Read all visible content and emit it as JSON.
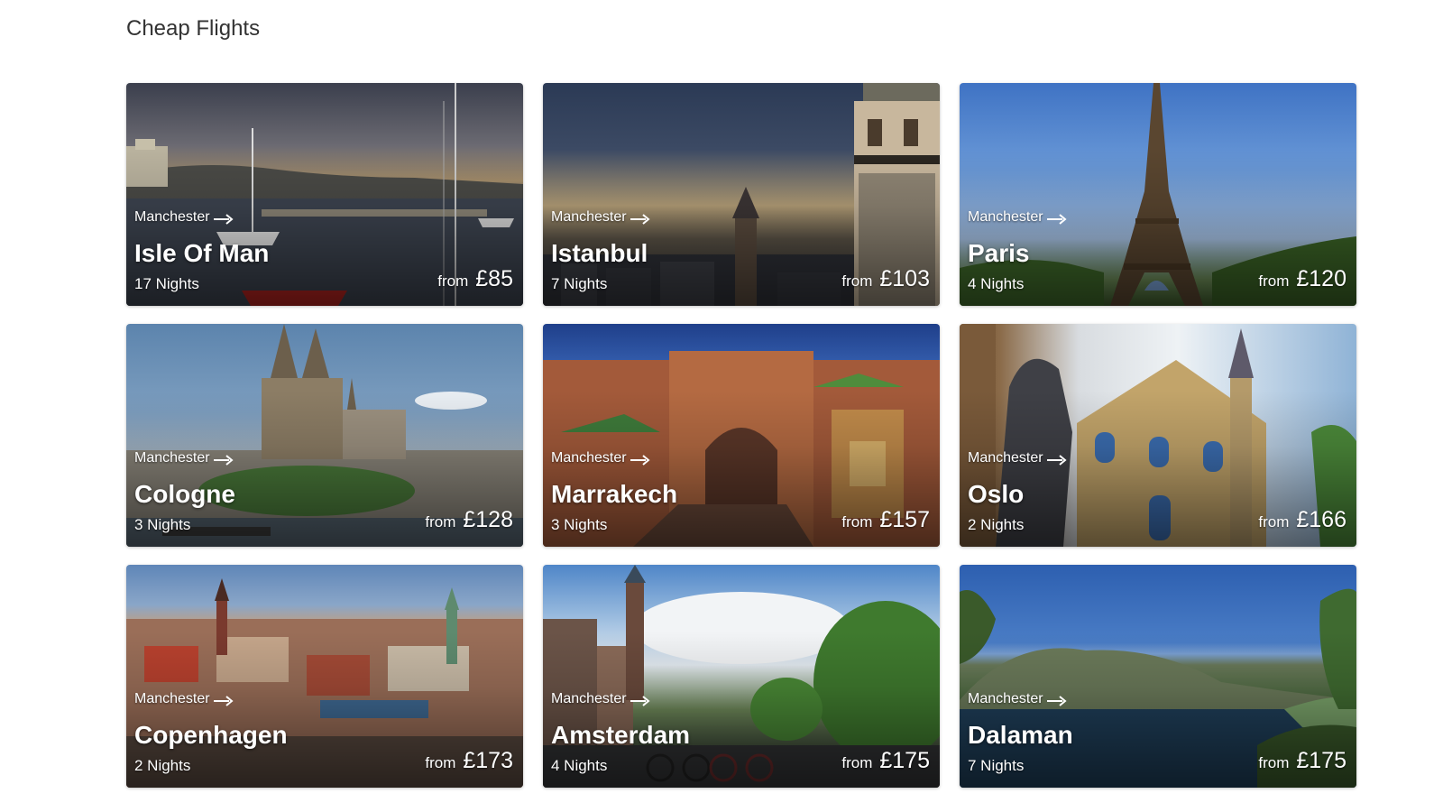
{
  "page": {
    "title": "Cheap Flights"
  },
  "cards": [
    {
      "origin": "Manchester",
      "destination": "Isle Of Man",
      "nights": "17 Nights",
      "from_label": "from",
      "price": "£85"
    },
    {
      "origin": "Manchester",
      "destination": "Istanbul",
      "nights": "7 Nights",
      "from_label": "from",
      "price": "£103"
    },
    {
      "origin": "Manchester",
      "destination": "Paris",
      "nights": "4 Nights",
      "from_label": "from",
      "price": "£120"
    },
    {
      "origin": "Manchester",
      "destination": "Cologne",
      "nights": "3 Nights",
      "from_label": "from",
      "price": "£128"
    },
    {
      "origin": "Manchester",
      "destination": "Marrakech",
      "nights": "3 Nights",
      "from_label": "from",
      "price": "£157"
    },
    {
      "origin": "Manchester",
      "destination": "Oslo",
      "nights": "2 Nights",
      "from_label": "from",
      "price": "£166"
    },
    {
      "origin": "Manchester",
      "destination": "Copenhagen",
      "nights": "2 Nights",
      "from_label": "from",
      "price": "£173"
    },
    {
      "origin": "Manchester",
      "destination": "Amsterdam",
      "nights": "4 Nights",
      "from_label": "from",
      "price": "£175"
    },
    {
      "origin": "Manchester",
      "destination": "Dalaman",
      "nights": "7 Nights",
      "from_label": "from",
      "price": "£175"
    }
  ],
  "icons": {
    "route_arrow": "arrow-right-icon"
  },
  "colors": {
    "card_text": "#ffffff",
    "title_text": "#333333"
  }
}
